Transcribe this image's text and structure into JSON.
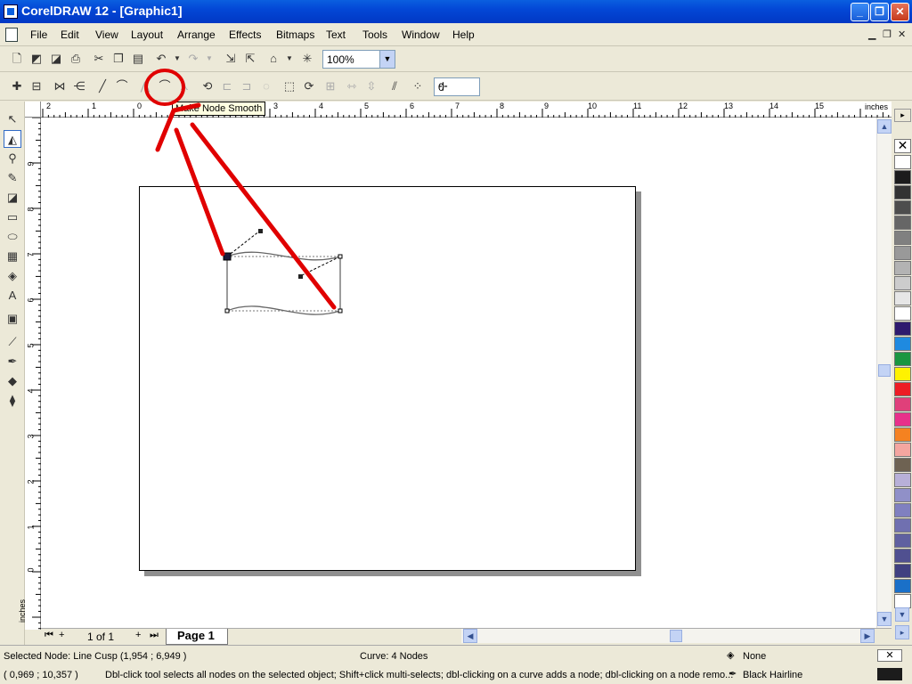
{
  "window": {
    "title": "CorelDRAW 12 - [Graphic1]",
    "min": "_",
    "max": "❐",
    "close": "✕"
  },
  "menu": [
    "File",
    "Edit",
    "View",
    "Layout",
    "Arrange",
    "Effects",
    "Bitmaps",
    "Text",
    "Tools",
    "Window",
    "Help"
  ],
  "toolbar": {
    "zoom": "100%",
    "nudge": "0"
  },
  "tooltip": "Make Node Smooth",
  "ruler": {
    "h_labels": [
      "2",
      "1",
      "0",
      "1",
      "2",
      "3",
      "4",
      "5",
      "6",
      "7",
      "8",
      "9",
      "10",
      "11",
      "12",
      "13",
      "14",
      "15"
    ],
    "h_units": "inches",
    "v_labels": [
      "9",
      "8",
      "7",
      "6",
      "5",
      "4",
      "3",
      "2",
      "1",
      "0"
    ],
    "v_units": "inches"
  },
  "pagebar": {
    "count": "1 of 1",
    "tab": "Page 1"
  },
  "status": {
    "selected": "Selected Node: Line Cusp (1,954 ; 6,949 )",
    "curve": "Curve: 4 Nodes",
    "fill": "None",
    "outline": "Black  Hairline",
    "coords": "( 0,969 ; 10,357 )",
    "hint": "Dbl-click tool selects all nodes on the selected object; Shift+click multi-selects; dbl-clicking on a curve adds a node; dbl-clicking on a node remo..."
  },
  "colors": {
    "palette": [
      "#ffffff",
      "#1c1c1c",
      "#333333",
      "#4d4d4d",
      "#666666",
      "#808080",
      "#999999",
      "#b3b3b3",
      "#cccccc",
      "#e6e6e6",
      "#ffffff",
      "#2e1a6e",
      "#1f8ae0",
      "#1a9640",
      "#fff200",
      "#ed1c24",
      "#e0407a",
      "#e8308a",
      "#f58220",
      "#f4a6a0",
      "#6e6252",
      "#b8b0d8",
      "#9090c8",
      "#8080c0",
      "#7070b0",
      "#6060a0",
      "#505090",
      "#404080",
      "#1a70c8",
      "#ffffff"
    ],
    "annotation": "#e00000"
  }
}
